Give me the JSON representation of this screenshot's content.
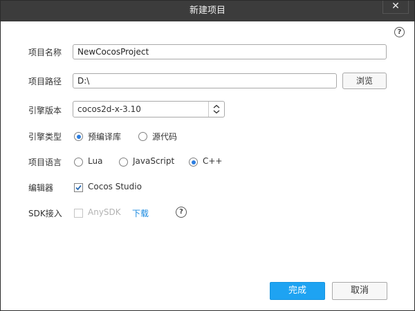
{
  "window": {
    "title": "新建项目",
    "close_label": "✕"
  },
  "help_top_label": "?",
  "form": {
    "project_name": {
      "label": "项目名称",
      "value": "NewCocosProject"
    },
    "project_path": {
      "label": "项目路径",
      "value": "D:\\",
      "browse_label": "浏览"
    },
    "engine_version": {
      "label": "引擎版本",
      "selected": "cocos2d-x-3.10"
    },
    "engine_type": {
      "label": "引擎类型",
      "options": [
        {
          "label": "预编译库",
          "checked": true
        },
        {
          "label": "源代码",
          "checked": false
        }
      ]
    },
    "project_language": {
      "label": "项目语言",
      "options": [
        {
          "label": "Lua",
          "checked": false
        },
        {
          "label": "JavaScript",
          "checked": false
        },
        {
          "label": "C++",
          "checked": true
        }
      ]
    },
    "editor": {
      "label": "编辑器",
      "checkbox_label": "Cocos Studio",
      "checked": true
    },
    "sdk": {
      "label": "SDK接入",
      "checkbox_label": "AnySDK",
      "checked": false,
      "disabled": true,
      "download_label": "下载",
      "help_label": "?"
    }
  },
  "footer": {
    "confirm_label": "完成",
    "cancel_label": "取消"
  },
  "colors": {
    "titlebar": "#3c3c3c",
    "accent": "#1ea3f2",
    "link": "#1a8ae0",
    "radio_checked": "#2b7de0",
    "checkbox_check": "#2b6cb5"
  }
}
